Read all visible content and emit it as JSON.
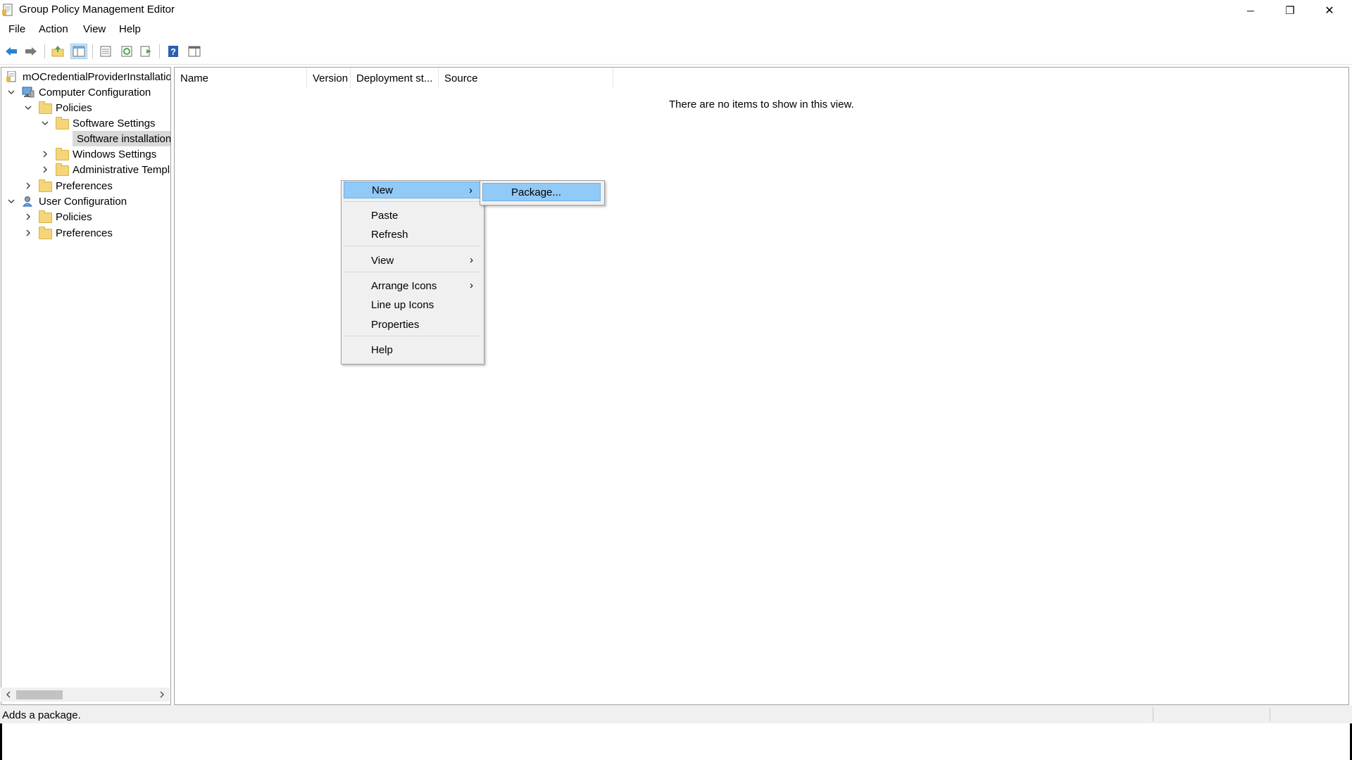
{
  "window": {
    "title": "Group Policy Management Editor",
    "minimize_glyph": "─",
    "restore_glyph": "❐",
    "close_glyph": "✕"
  },
  "menubar": {
    "items": [
      "File",
      "Action",
      "View",
      "Help"
    ]
  },
  "toolbar": {
    "icons": [
      "back-arrow-icon",
      "forward-arrow-icon",
      "up-folder-icon",
      "show-hide-tree-icon",
      "properties-icon",
      "refresh-icon",
      "export-list-icon",
      "help-icon",
      "show-action-pane-icon"
    ]
  },
  "tree": {
    "items": [
      {
        "label": "mOCredentialProviderInstallation",
        "icon": "gpo-icon"
      },
      {
        "label": "Computer Configuration",
        "icon": "computer-icon",
        "expanded": true
      },
      {
        "label": "Policies",
        "icon": "folder-icon",
        "expanded": true
      },
      {
        "label": "Software Settings",
        "icon": "folder-icon",
        "expanded": true
      },
      {
        "label": "Software installation",
        "icon": "software-installation-icon",
        "selected": true
      },
      {
        "label": "Windows Settings",
        "icon": "folder-icon",
        "expanded": false
      },
      {
        "label": "Administrative Templates",
        "icon": "folder-icon",
        "expanded": false
      },
      {
        "label": "Preferences",
        "icon": "folder-icon",
        "expanded": false
      },
      {
        "label": "User Configuration",
        "icon": "user-icon",
        "expanded": true
      },
      {
        "label": "Policies",
        "icon": "folder-icon",
        "expanded": false
      },
      {
        "label": "Preferences",
        "icon": "folder-icon",
        "expanded": false
      }
    ]
  },
  "content": {
    "columns": [
      "Name",
      "Version",
      "Deployment st...",
      "Source"
    ],
    "empty_message": "There are no items to show in this view."
  },
  "context_menu": {
    "items": [
      {
        "label": "New",
        "submenu": true,
        "highlighted": true
      },
      {
        "label": "Paste"
      },
      {
        "label": "Refresh"
      },
      {
        "label": "View",
        "submenu": true
      },
      {
        "label": "Arrange Icons",
        "submenu": true
      },
      {
        "label": "Line up Icons"
      },
      {
        "label": "Properties"
      },
      {
        "label": "Help"
      }
    ],
    "submenu_arrow": "›",
    "submenu": {
      "items": [
        {
          "label": "Package...",
          "highlighted": true
        }
      ]
    }
  },
  "statusbar": {
    "text": "Adds a package."
  },
  "colors": {
    "highlight": "#91c9f7",
    "highlight_border": "#6cb0e8",
    "menu_bg": "#f0f0f0",
    "selected_tree": "#d9d9d9",
    "folder": "#f4d57a",
    "toolbar_blue": "#2a7fd4",
    "toolbar_green": "#4aa84a"
  }
}
